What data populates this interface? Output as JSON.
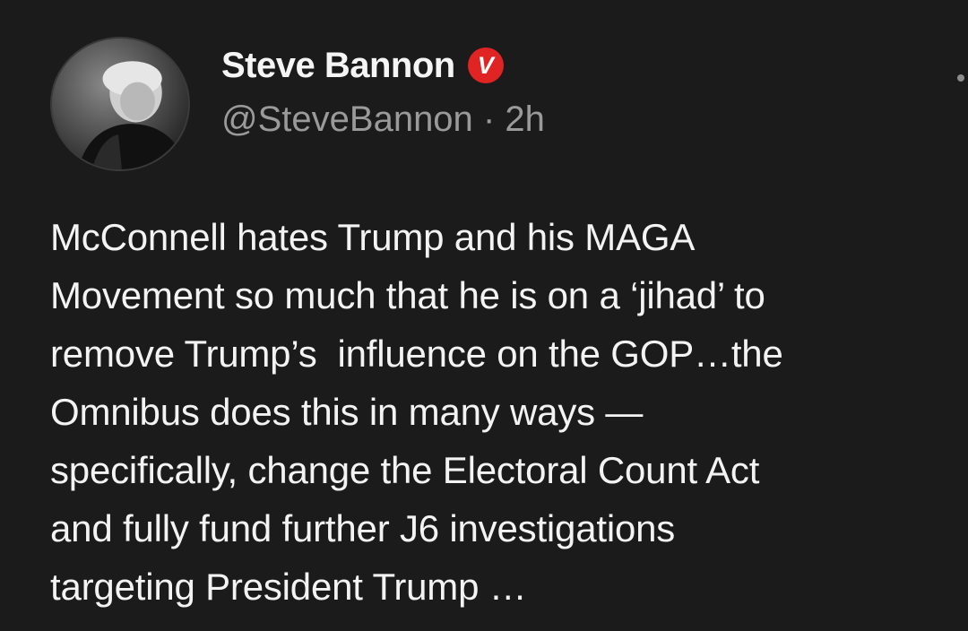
{
  "post": {
    "author": {
      "display_name": "Steve Bannon",
      "badge_icon": "verified-badge-icon",
      "badge_letter": "V",
      "badge_color": "#e02424",
      "handle": "@SteveBannon",
      "separator": "·",
      "time": "2h"
    },
    "more_icon": "more-options-icon",
    "body_lines": [
      "McConnell hates Trump and his MAGA",
      "Movement so much that he is on a ‘jihad’ to",
      "remove Trump’s  influence on the GOP…the",
      "Omnibus does this in many ways —",
      "specifically, change the Electoral Count Act",
      "and fully fund further J6 investigations",
      "targeting President Trump …"
    ]
  },
  "theme": {
    "background": "#1b1b1b",
    "text": "#f3f3f3",
    "muted": "#9a9a9a"
  }
}
